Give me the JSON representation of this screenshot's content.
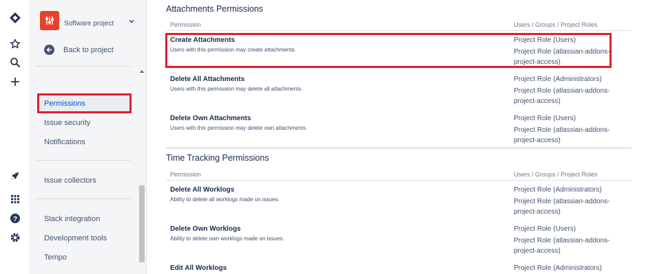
{
  "rail": {
    "icons": [
      "jira-logo-icon",
      "star-icon",
      "search-icon",
      "plus-icon",
      "rocket-icon",
      "apps-grid-icon",
      "help-icon",
      "settings-gear-icon"
    ]
  },
  "sidebar": {
    "project_name": "Software project",
    "back_label": "Back to project",
    "items": {
      "permissions": "Permissions",
      "issue_security": "Issue security",
      "notifications": "Notifications",
      "issue_collectors": "Issue collectors",
      "slack_integration": "Slack integration",
      "development_tools": "Development tools",
      "tempo": "Tempo"
    }
  },
  "main": {
    "attachments": {
      "title": "Attachments Permissions",
      "col_permission": "Permission",
      "col_roles": "Users / Groups / Project Roles",
      "rows": [
        {
          "name": "Create Attachments",
          "desc": "Users with this permission may create attachments.",
          "role1": "Project Role (Users)",
          "role2": "Project Role (atlassian-addons-project-access)"
        },
        {
          "name": "Delete All Attachments",
          "desc": "Users with this permission may delete all attachments.",
          "role1": "Project Role (Administrators)",
          "role2": "Project Role (atlassian-addons-project-access)"
        },
        {
          "name": "Delete Own Attachments",
          "desc": "Users with this permission may delete own attachments.",
          "role1": "Project Role (Users)",
          "role2": "Project Role (atlassian-addons-project-access)"
        }
      ]
    },
    "time_tracking": {
      "title": "Time Tracking Permissions",
      "col_permission": "Permission",
      "col_roles": "Users / Groups / Project Roles",
      "rows": [
        {
          "name": "Delete All Worklogs",
          "desc": "Ability to delete all worklogs made on issues.",
          "role1": "Project Role (Administrators)",
          "role2": "Project Role (atlassian-addons-project-access)"
        },
        {
          "name": "Delete Own Worklogs",
          "desc": "Ability to delete own worklogs made on issues.",
          "role1": "Project Role (Users)",
          "role2": "Project Role (atlassian-addons-project-access)"
        },
        {
          "name": "Edit All Worklogs",
          "role1": "Project Role (Administrators)"
        }
      ]
    }
  },
  "colors": {
    "highlight": "#e01e2b",
    "link_active": "#0052cc",
    "project_avatar": "#e8402c"
  }
}
